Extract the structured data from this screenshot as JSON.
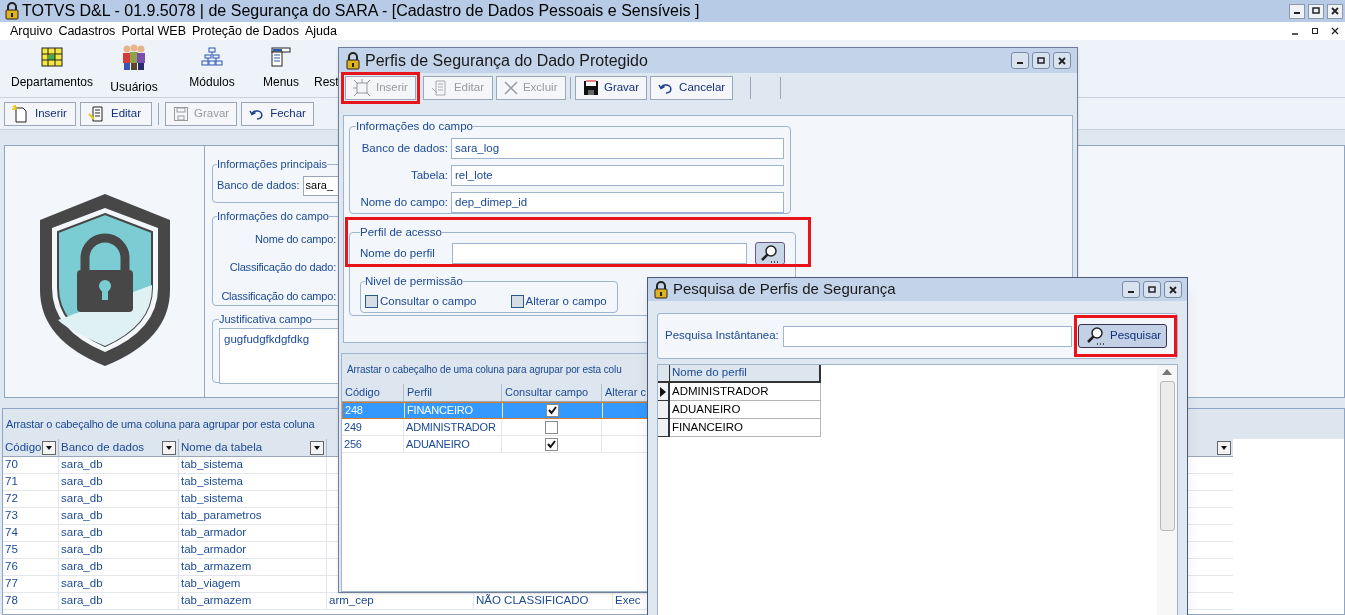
{
  "window": {
    "title": "TOTVS D&L - 01.9.5078 | de Segurança do SARA - [Cadastro de Dados Pessoais e Sensíveis ]"
  },
  "menu": [
    "Arquivo",
    "Cadastros",
    "Portal WEB",
    "Proteção de Dados",
    "Ajuda"
  ],
  "main_toolbar": [
    {
      "label": "Departamentos",
      "kind": "grid"
    },
    {
      "label": "Usuários",
      "kind": "people"
    },
    {
      "label": "Módulos",
      "kind": "tree"
    },
    {
      "label": "Menus",
      "kind": "menu"
    },
    {
      "label": "Rest",
      "kind": "text"
    }
  ],
  "actions": [
    {
      "label": "Inserir",
      "kind": "new",
      "disabled": false
    },
    {
      "label": "Editar",
      "kind": "edit",
      "disabled": false
    },
    {
      "label": "Gravar",
      "kind": "save",
      "disabled": true
    },
    {
      "label": "Fechar",
      "kind": "undo",
      "disabled": false
    }
  ],
  "main_form": {
    "main_info": {
      "title": "Informações principais",
      "label": "Banco de dados:",
      "value": "sara_"
    },
    "field_info": {
      "title": "Informações do campo",
      "labels": [
        "Nome do campo:",
        "Classificação do dado:",
        "Classificação do campo:"
      ]
    },
    "justification": {
      "title": "Justificativa campo",
      "value": "gugfudgfkdgfdkg"
    }
  },
  "main_grid": {
    "group_hint": "Arrastar o cabeçalho de uma coluna para agrupar por esta coluna",
    "columns": [
      "Código",
      "Banco de dados",
      "Nome da tabela"
    ],
    "rows": [
      {
        "cells": [
          "70",
          "sara_db",
          "tab_sistema"
        ]
      },
      {
        "cells": [
          "71",
          "sara_db",
          "tab_sistema"
        ]
      },
      {
        "cells": [
          "72",
          "sara_db",
          "tab_sistema"
        ]
      },
      {
        "cells": [
          "73",
          "sara_db",
          "tab_parametros"
        ]
      },
      {
        "cells": [
          "74",
          "sara_db",
          "tab_armador"
        ]
      },
      {
        "cells": [
          "75",
          "sara_db",
          "tab_armador"
        ]
      },
      {
        "cells": [
          "76",
          "sara_db",
          "tab_armazem"
        ]
      },
      {
        "cells": [
          "77",
          "sara_db",
          "tab_viagem"
        ]
      },
      {
        "cells": [
          "78",
          "sara_db",
          "tab_armazem",
          "arm_cep",
          "NÃO CLASSIFICADO",
          "Exec"
        ]
      }
    ]
  },
  "profiles_dialog": {
    "title": "Perfis de Segurança do Dado Protegido",
    "toolbar": [
      {
        "label": "Inserir",
        "kind": "new",
        "disabled": true,
        "highlighted": true
      },
      {
        "label": "Editar",
        "kind": "edit",
        "disabled": true,
        "highlighted": false
      },
      {
        "label": "Excluir",
        "kind": "delete",
        "disabled": true,
        "highlighted": false
      },
      {
        "label": "Gravar",
        "kind": "save",
        "disabled": false,
        "highlighted": false
      },
      {
        "label": "Cancelar",
        "kind": "undo",
        "disabled": false,
        "highlighted": false
      }
    ],
    "field_info": {
      "title": "Informações do campo",
      "fields": [
        {
          "label": "Banco de dados:",
          "value": "sara_log"
        },
        {
          "label": "Tabela:",
          "value": "rel_lote"
        },
        {
          "label": "Nome do campo:",
          "value": "dep_dimep_id"
        }
      ]
    },
    "access": {
      "title": "Perfil de acesso",
      "highlighted": true,
      "label": "Nome do perfil",
      "permission_title": "Nivel de permissão",
      "permissions": [
        {
          "label": "Consultar o campo",
          "checked": false
        },
        {
          "label": "Alterar o campo",
          "checked": false
        }
      ]
    },
    "grid": {
      "group_hint": "Arrastar o cabeçalho de uma coluna para agrupar por esta colu",
      "columns": [
        "Código",
        "Perfil",
        "Consultar campo",
        "Alterar c"
      ],
      "rows": [
        {
          "code": "248",
          "profile": "FINANCEIRO",
          "consult": true,
          "selected": true
        },
        {
          "code": "249",
          "profile": "ADMINISTRADOR",
          "consult": false,
          "selected": false
        },
        {
          "code": "256",
          "profile": "ADUANEIRO",
          "consult": true,
          "selected": false
        }
      ]
    }
  },
  "search_dialog": {
    "title": "Pesquisa de Perfis de Segurança",
    "search_label": "Pesquisa Instântanea:",
    "button": {
      "label": "Pesquisar",
      "highlighted": true
    },
    "column": "Nome do perfil",
    "rows": [
      {
        "name": "ADMINISTRADOR",
        "selected": true
      },
      {
        "name": "ADUANEIRO",
        "selected": false
      },
      {
        "name": "FINANCEIRO",
        "selected": false
      }
    ]
  }
}
